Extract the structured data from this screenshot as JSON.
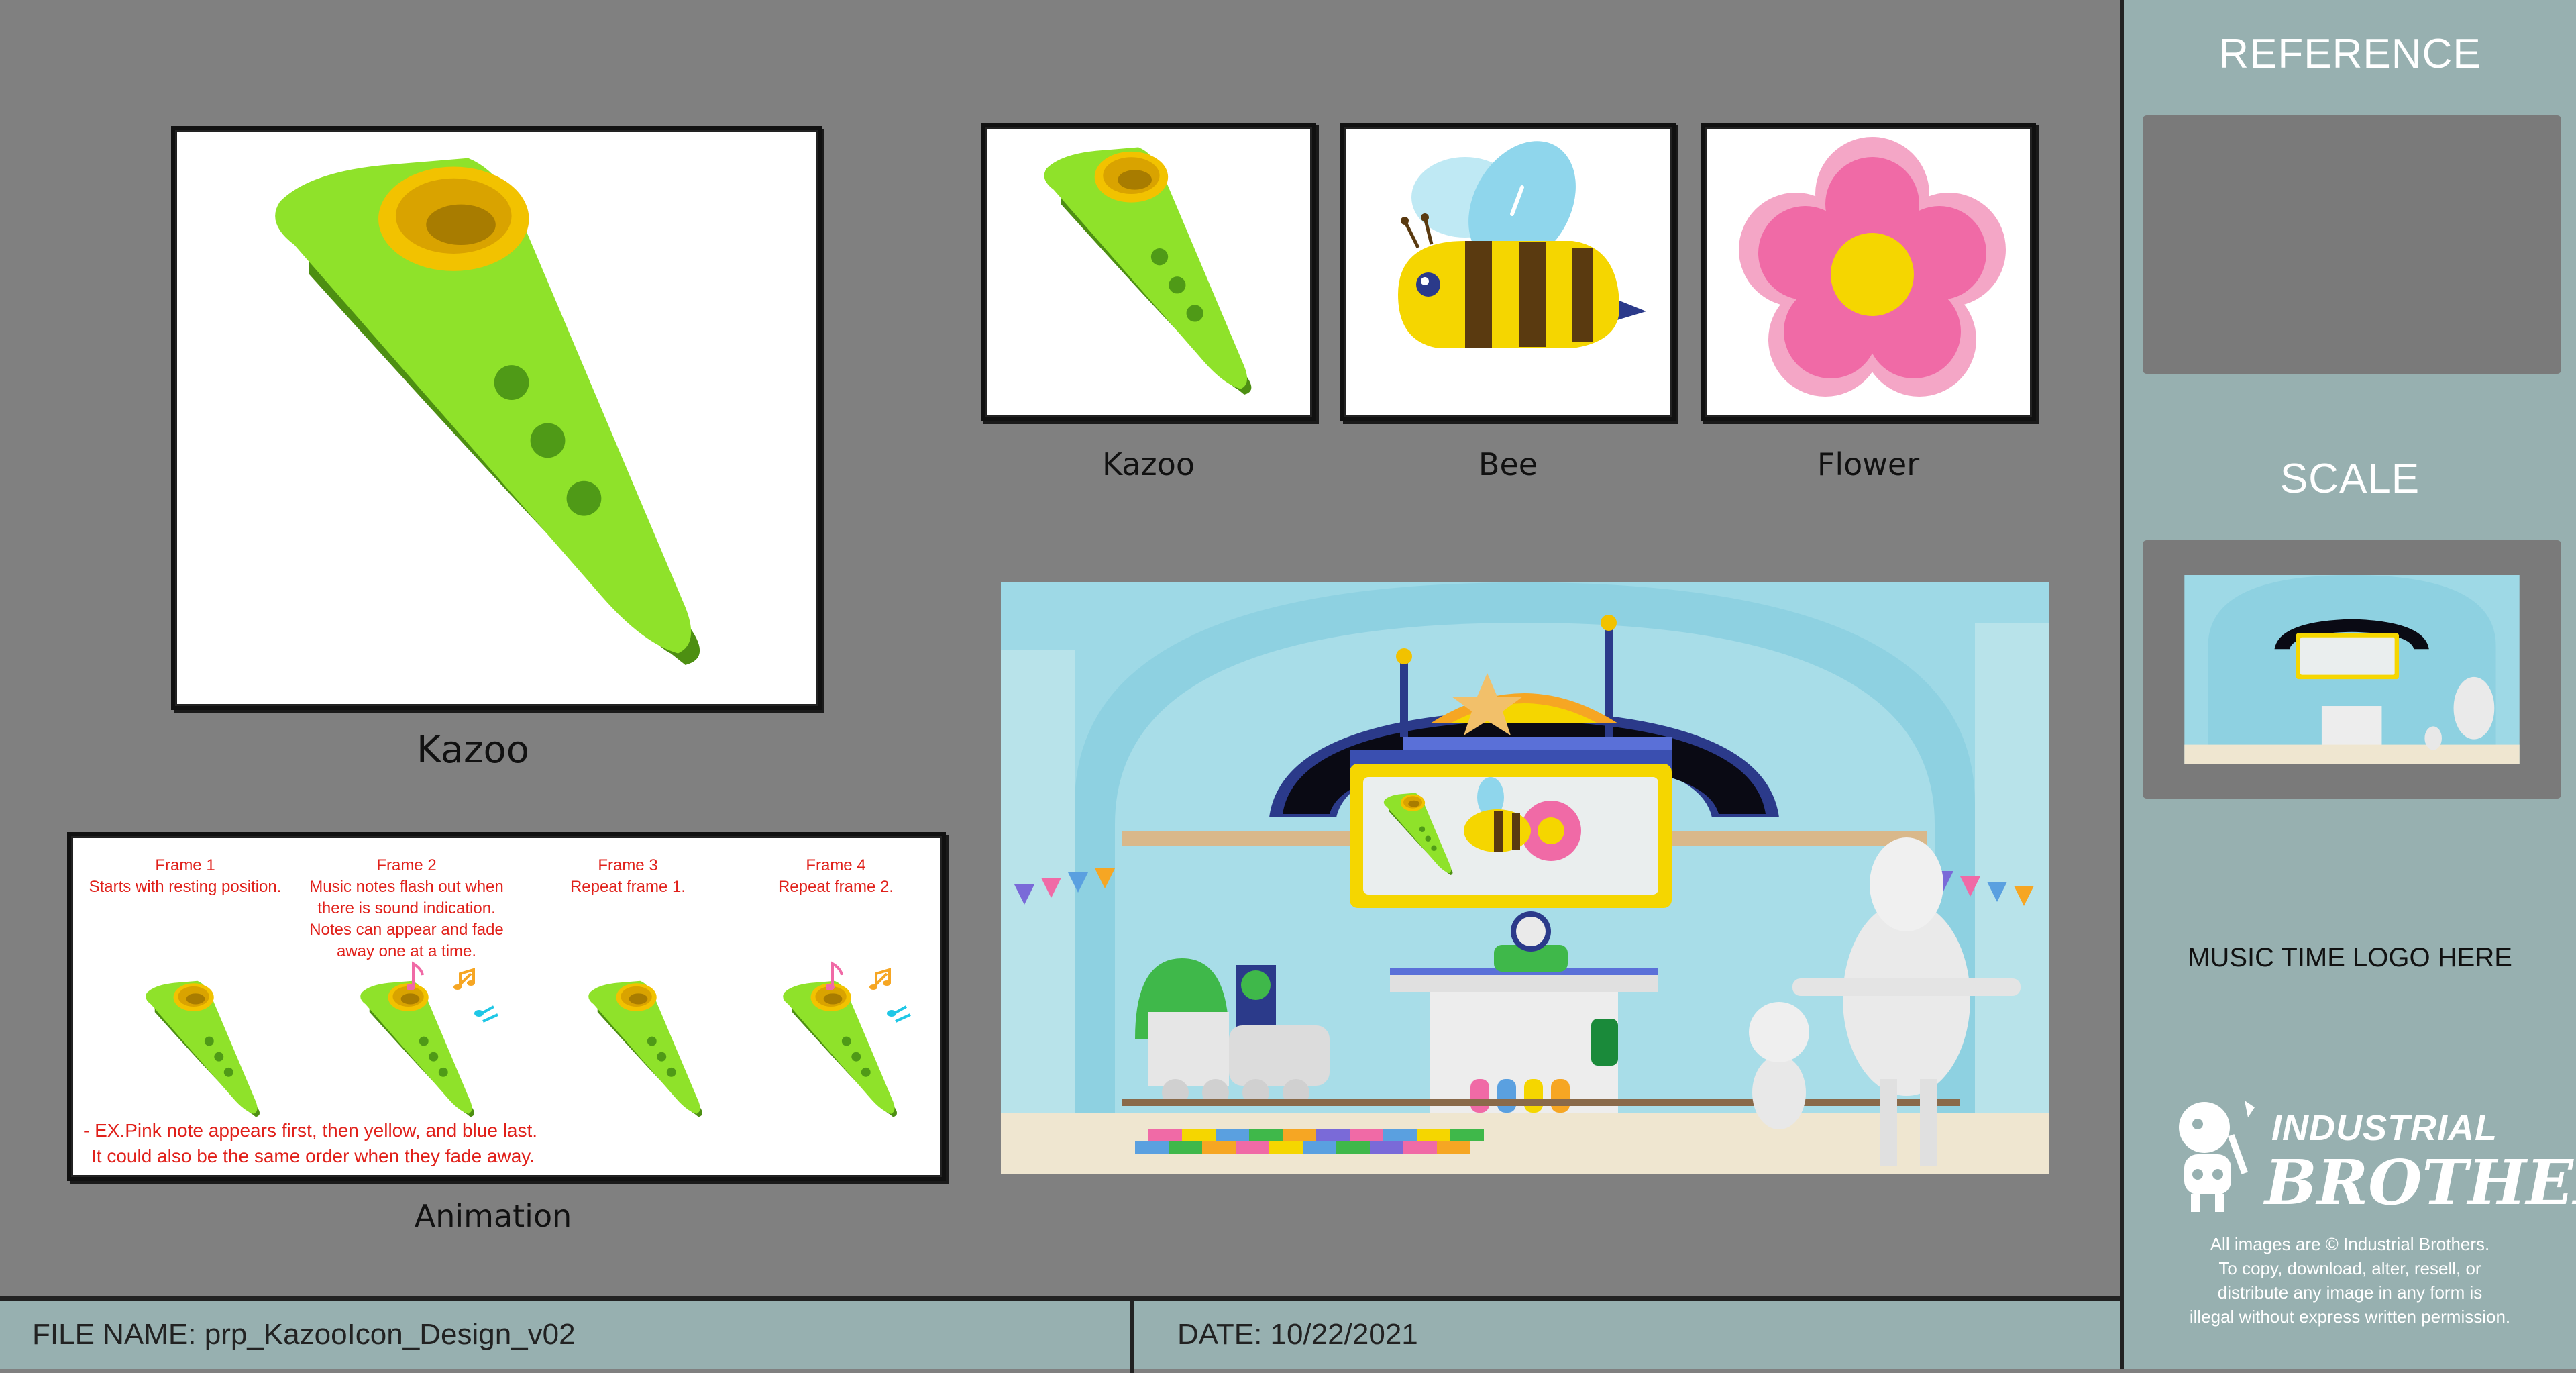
{
  "main": {
    "hero_label": "Kazoo",
    "icons": [
      {
        "label": "Kazoo",
        "icon": "kazoo-icon"
      },
      {
        "label": "Bee",
        "icon": "bee-icon"
      },
      {
        "label": "Flower",
        "icon": "flower-icon"
      }
    ],
    "animation": {
      "label": "Animation",
      "frames": [
        {
          "title": "Frame 1",
          "text": "Starts with resting position."
        },
        {
          "title": "Frame 2",
          "text": "Music notes flash out when there is sound indication. Notes can appear and fade away one at a time."
        },
        {
          "title": "Frame 3",
          "text": "Repeat frame 1."
        },
        {
          "title": "Frame 4",
          "text": "Repeat frame 2."
        }
      ],
      "note_line1": "- EX.Pink note appears first, then yellow, and blue last.",
      "note_line2": "It could also be the same order when they fade away."
    }
  },
  "sidebar": {
    "reference_title": "REFERENCE",
    "scale_title": "SCALE",
    "logo_placeholder": "MUSIC TIME LOGO HERE",
    "brand_line1": "INDUSTRIAL",
    "brand_line2": "BROTHERS",
    "copyright": [
      "All images are © Industrial Brothers.",
      "To copy, download, alter, resell, or",
      "distribute any image in any form is",
      "illegal without express written permission."
    ]
  },
  "footer": {
    "file_label": "FILE NAME:",
    "file_value": "prp_KazooIcon_Design_v02",
    "date_label": "DATE:",
    "date_value": "10/22/2021"
  },
  "colors": {
    "background": "#808080",
    "panel": "#97b0b0",
    "kazoo_green": "#8fe22a",
    "kazoo_yellow": "#f2c200",
    "bee_yellow": "#f5d600",
    "bee_brown": "#5a3a10",
    "flower_pink": "#f06aa6",
    "flower_light": "#f4a6c6",
    "note_pink": "#f06aa6",
    "note_orange": "#f6a623",
    "note_blue": "#1fc7e6",
    "caption_red": "#e0201a"
  }
}
